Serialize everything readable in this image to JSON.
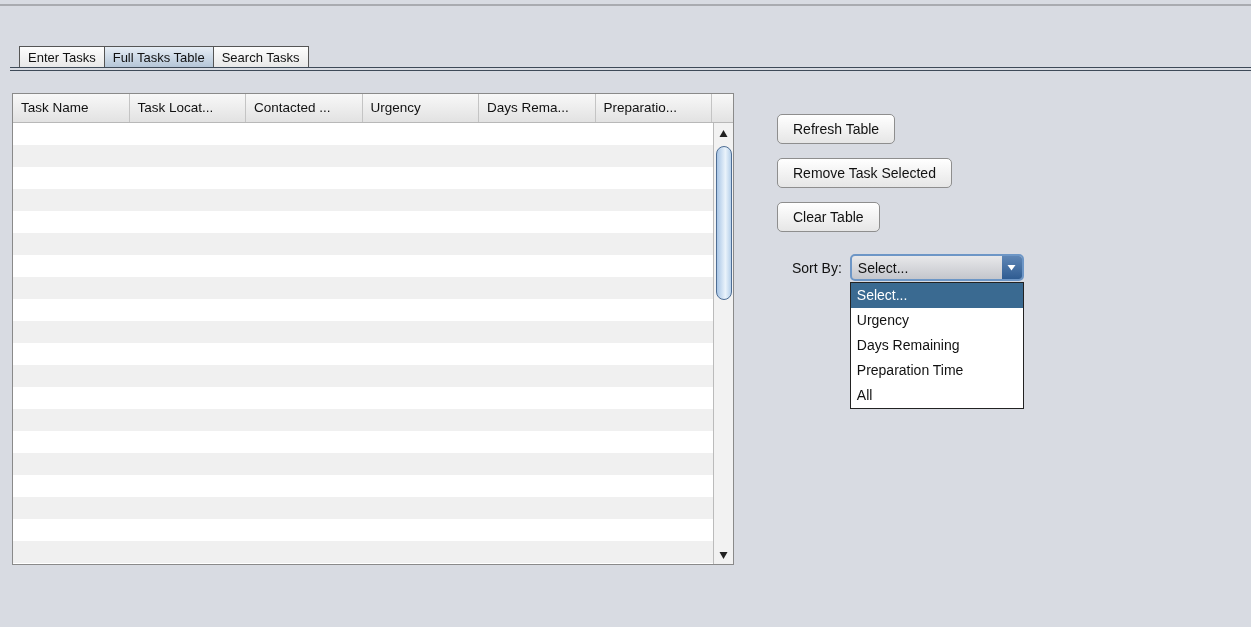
{
  "tabs": [
    {
      "label": "Enter Tasks",
      "selected": false
    },
    {
      "label": "Full Tasks Table",
      "selected": true
    },
    {
      "label": "Search Tasks",
      "selected": false
    }
  ],
  "table": {
    "columns": [
      "Task Name",
      "Task Locat...",
      "Contacted ...",
      "Urgency",
      "Days Rema...",
      "Preparatio..."
    ]
  },
  "buttons": [
    "Refresh Table",
    "Remove Task Selected",
    "Clear Table"
  ],
  "sort": {
    "label": "Sort By:",
    "value": "Select...",
    "expanded": true,
    "options": [
      {
        "label": "Select...",
        "selected": true
      },
      {
        "label": "Urgency",
        "selected": false
      },
      {
        "label": "Days Remaining",
        "selected": false
      },
      {
        "label": "Preparation Time",
        "selected": false
      },
      {
        "label": "All",
        "selected": false
      }
    ]
  }
}
